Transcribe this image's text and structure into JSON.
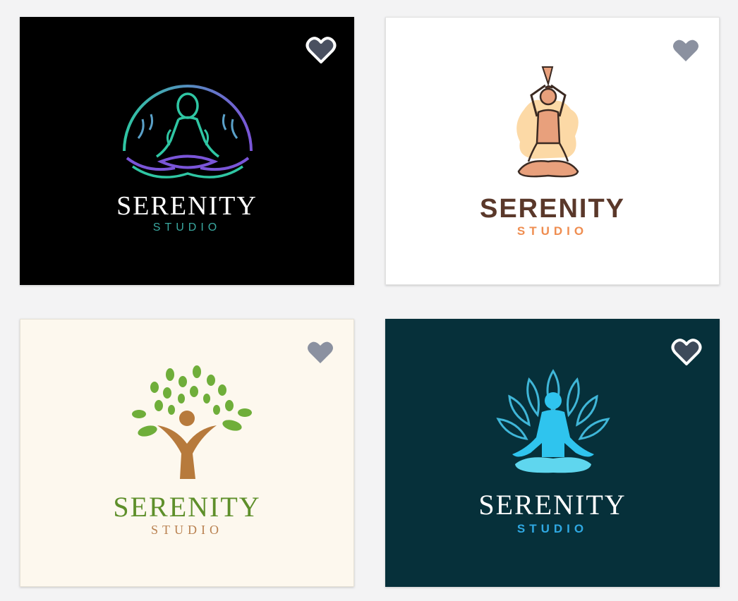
{
  "cards": [
    {
      "title": "SERENITY",
      "subtitle": "STUDIO",
      "favorited": true,
      "heart_icon": "heart-icon"
    },
    {
      "title": "SERENITY",
      "subtitle": "STUDIO",
      "favorited": false,
      "heart_icon": "heart-icon"
    },
    {
      "title": "SERENITY",
      "subtitle": "STUDIO",
      "favorited": false,
      "heart_icon": "heart-icon"
    },
    {
      "title": "SERENITY",
      "subtitle": "STUDIO",
      "favorited": true,
      "heart_icon": "heart-icon"
    }
  ],
  "colors": {
    "card1_bg": "#000000",
    "card2_bg": "#ffffff",
    "card3_bg": "#fdf8ee",
    "card4_bg": "#06303a",
    "heart_fill": "#6b7280",
    "heart_outline": "#ffffff"
  }
}
